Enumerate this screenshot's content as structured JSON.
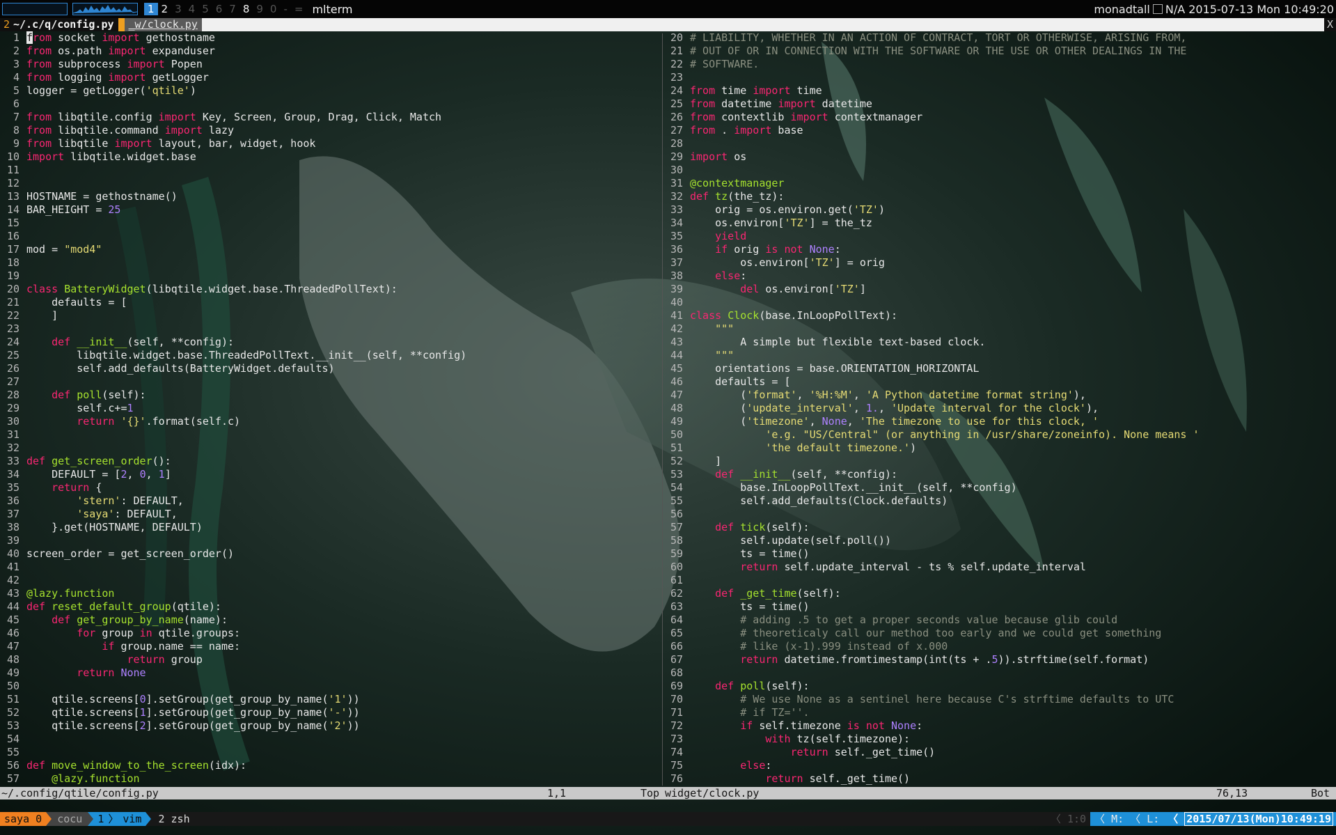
{
  "topbar": {
    "groups": [
      {
        "label": "1",
        "state": "active"
      },
      {
        "label": "2",
        "state": "occupied"
      },
      {
        "label": "3",
        "state": "empty"
      },
      {
        "label": "4",
        "state": "empty"
      },
      {
        "label": "5",
        "state": "empty"
      },
      {
        "label": "6",
        "state": "empty"
      },
      {
        "label": "7",
        "state": "empty"
      },
      {
        "label": "8",
        "state": "occupied"
      },
      {
        "label": "9",
        "state": "empty"
      },
      {
        "label": "0",
        "state": "empty"
      },
      {
        "label": "-",
        "state": "empty"
      },
      {
        "label": "=",
        "state": "empty"
      }
    ],
    "window_title": "mlterm",
    "hostname": "monadtall",
    "battery": "N/A",
    "clock": "2015-07-13 Mon 10:49:20",
    "accent_color": "#2f86d3"
  },
  "tabline": {
    "count": "2",
    "current": "~/.c/q/config.py",
    "other": "_w/clock.py",
    "close": "X"
  },
  "left_pane": {
    "lines": [
      {
        "n": "1",
        "cursor": "f",
        "code": "rom socket import gethostname"
      },
      {
        "n": "2",
        "code": "from os.path import expanduser"
      },
      {
        "n": "3",
        "code": "from subprocess import Popen"
      },
      {
        "n": "4",
        "code": "from logging import getLogger"
      },
      {
        "n": "5",
        "code": "logger = getLogger('qtile')"
      },
      {
        "n": "6",
        "code": ""
      },
      {
        "n": "7",
        "code": "from libqtile.config import Key, Screen, Group, Drag, Click, Match"
      },
      {
        "n": "8",
        "code": "from libqtile.command import lazy"
      },
      {
        "n": "9",
        "code": "from libqtile import layout, bar, widget, hook"
      },
      {
        "n": "10",
        "code": "import libqtile.widget.base"
      },
      {
        "n": "11",
        "code": ""
      },
      {
        "n": "12",
        "code": ""
      },
      {
        "n": "13",
        "code": "HOSTNAME = gethostname()"
      },
      {
        "n": "14",
        "code": "BAR_HEIGHT = 25"
      },
      {
        "n": "15",
        "code": ""
      },
      {
        "n": "16",
        "code": ""
      },
      {
        "n": "17",
        "code": "mod = \"mod4\""
      },
      {
        "n": "18",
        "code": ""
      },
      {
        "n": "19",
        "code": ""
      },
      {
        "n": "20",
        "code": "class BatteryWidget(libqtile.widget.base.ThreadedPollText):"
      },
      {
        "n": "21",
        "code": "    defaults = ["
      },
      {
        "n": "22",
        "code": "    ]"
      },
      {
        "n": "23",
        "code": ""
      },
      {
        "n": "24",
        "code": "    def __init__(self, **config):"
      },
      {
        "n": "25",
        "code": "        libqtile.widget.base.ThreadedPollText.__init__(self, **config)"
      },
      {
        "n": "26",
        "code": "        self.add_defaults(BatteryWidget.defaults)"
      },
      {
        "n": "27",
        "code": ""
      },
      {
        "n": "28",
        "code": "    def poll(self):"
      },
      {
        "n": "29",
        "code": "        self.c+=1"
      },
      {
        "n": "30",
        "code": "        return '{}'.format(self.c)"
      },
      {
        "n": "31",
        "code": ""
      },
      {
        "n": "32",
        "code": ""
      },
      {
        "n": "33",
        "code": "def get_screen_order():"
      },
      {
        "n": "34",
        "code": "    DEFAULT = [2, 0, 1]"
      },
      {
        "n": "35",
        "code": "    return {"
      },
      {
        "n": "36",
        "code": "        'stern': DEFAULT,"
      },
      {
        "n": "37",
        "code": "        'saya': DEFAULT,"
      },
      {
        "n": "38",
        "code": "    }.get(HOSTNAME, DEFAULT)"
      },
      {
        "n": "39",
        "code": ""
      },
      {
        "n": "40",
        "code": "screen_order = get_screen_order()"
      },
      {
        "n": "41",
        "code": ""
      },
      {
        "n": "42",
        "code": ""
      },
      {
        "n": "43",
        "code": "@lazy.function"
      },
      {
        "n": "44",
        "code": "def reset_default_group(qtile):"
      },
      {
        "n": "45",
        "code": "    def get_group_by_name(name):"
      },
      {
        "n": "46",
        "code": "        for group in qtile.groups:"
      },
      {
        "n": "47",
        "code": "            if group.name == name:"
      },
      {
        "n": "48",
        "code": "                return group"
      },
      {
        "n": "49",
        "code": "        return None"
      },
      {
        "n": "50",
        "code": ""
      },
      {
        "n": "51",
        "code": "    qtile.screens[0].setGroup(get_group_by_name('1'))"
      },
      {
        "n": "52",
        "code": "    qtile.screens[1].setGroup(get_group_by_name('-'))"
      },
      {
        "n": "53",
        "code": "    qtile.screens[2].setGroup(get_group_by_name('2'))"
      },
      {
        "n": "54",
        "code": ""
      },
      {
        "n": "55",
        "code": ""
      },
      {
        "n": "56",
        "code": "def move_window_to_the_screen(idx):"
      },
      {
        "n": "57",
        "code": "    @lazy.function"
      }
    ],
    "status": {
      "file": "~/.config/qtile/config.py",
      "position": "1,1",
      "scroll": "Top"
    }
  },
  "right_pane": {
    "lines": [
      {
        "n": "20",
        "code": "# LIABILITY, WHETHER IN AN ACTION OF CONTRACT, TORT OR OTHERWISE, ARISING FROM,"
      },
      {
        "n": "21",
        "code": "# OUT OF OR IN CONNECTION WITH THE SOFTWARE OR THE USE OR OTHER DEALINGS IN THE"
      },
      {
        "n": "22",
        "code": "# SOFTWARE."
      },
      {
        "n": "23",
        "code": ""
      },
      {
        "n": "24",
        "code": "from time import time"
      },
      {
        "n": "25",
        "code": "from datetime import datetime"
      },
      {
        "n": "26",
        "code": "from contextlib import contextmanager"
      },
      {
        "n": "27",
        "code": "from . import base"
      },
      {
        "n": "28",
        "code": ""
      },
      {
        "n": "29",
        "code": "import os"
      },
      {
        "n": "30",
        "code": ""
      },
      {
        "n": "31",
        "code": "@contextmanager"
      },
      {
        "n": "32",
        "code": "def tz(the_tz):"
      },
      {
        "n": "33",
        "code": "    orig = os.environ.get('TZ')"
      },
      {
        "n": "34",
        "code": "    os.environ['TZ'] = the_tz"
      },
      {
        "n": "35",
        "code": "    yield"
      },
      {
        "n": "36",
        "code": "    if orig is not None:"
      },
      {
        "n": "37",
        "code": "        os.environ['TZ'] = orig"
      },
      {
        "n": "38",
        "code": "    else:"
      },
      {
        "n": "39",
        "code": "        del os.environ['TZ']"
      },
      {
        "n": "40",
        "code": ""
      },
      {
        "n": "41",
        "code": "class Clock(base.InLoopPollText):"
      },
      {
        "n": "42",
        "code": "    \"\"\""
      },
      {
        "n": "43",
        "code": "        A simple but flexible text-based clock."
      },
      {
        "n": "44",
        "code": "    \"\"\""
      },
      {
        "n": "45",
        "code": "    orientations = base.ORIENTATION_HORIZONTAL"
      },
      {
        "n": "46",
        "code": "    defaults = ["
      },
      {
        "n": "47",
        "code": "        ('format', '%H:%M', 'A Python datetime format string'),"
      },
      {
        "n": "48",
        "code": "        ('update_interval', 1., 'Update interval for the clock'),"
      },
      {
        "n": "49",
        "code": "        ('timezone', None, 'The timezone to use for this clock, '"
      },
      {
        "n": "50",
        "code": "            'e.g. \"US/Central\" (or anything in /usr/share/zoneinfo). None means '"
      },
      {
        "n": "51",
        "code": "            'the default timezone.')"
      },
      {
        "n": "52",
        "code": "    ]"
      },
      {
        "n": "53",
        "code": "    def __init__(self, **config):"
      },
      {
        "n": "54",
        "code": "        base.InLoopPollText.__init__(self, **config)"
      },
      {
        "n": "55",
        "code": "        self.add_defaults(Clock.defaults)"
      },
      {
        "n": "56",
        "code": ""
      },
      {
        "n": "57",
        "code": "    def tick(self):"
      },
      {
        "n": "58",
        "code": "        self.update(self.poll())"
      },
      {
        "n": "59",
        "code": "        ts = time()"
      },
      {
        "n": "60",
        "code": "        return self.update_interval - ts % self.update_interval"
      },
      {
        "n": "61",
        "code": ""
      },
      {
        "n": "62",
        "code": "    def _get_time(self):"
      },
      {
        "n": "63",
        "code": "        ts = time()"
      },
      {
        "n": "64",
        "code": "        # adding .5 to get a proper seconds value because glib could"
      },
      {
        "n": "65",
        "code": "        # theoreticaly call our method too early and we could get something"
      },
      {
        "n": "66",
        "code": "        # like (x-1).999 instead of x.000"
      },
      {
        "n": "67",
        "code": "        return datetime.fromtimestamp(int(ts + .5)).strftime(self.format)"
      },
      {
        "n": "68",
        "code": ""
      },
      {
        "n": "69",
        "code": "    def poll(self):"
      },
      {
        "n": "70",
        "code": "        # We use None as a sentinel here because C's strftime defaults to UTC"
      },
      {
        "n": "71",
        "code": "        # if TZ=''."
      },
      {
        "n": "72",
        "code": "        if self.timezone is not None:"
      },
      {
        "n": "73",
        "code": "            with tz(self.timezone):"
      },
      {
        "n": "74",
        "code": "                return self._get_time()"
      },
      {
        "n": "75",
        "code": "        else:"
      },
      {
        "n": "76",
        "code": "            return self._get_time()"
      }
    ],
    "status": {
      "file": "widget/clock.py",
      "position": "76,13",
      "scroll": "Bot"
    }
  },
  "tmux": {
    "session": "saya 0",
    "host": "cocu",
    "window1_index": "1",
    "window1_name": "vim",
    "window2": "2 zsh",
    "load": "1:0",
    "mode_m": "M:",
    "mode_l": "L:",
    "datetime": "2015/07/13(Mon)10:49:19"
  }
}
